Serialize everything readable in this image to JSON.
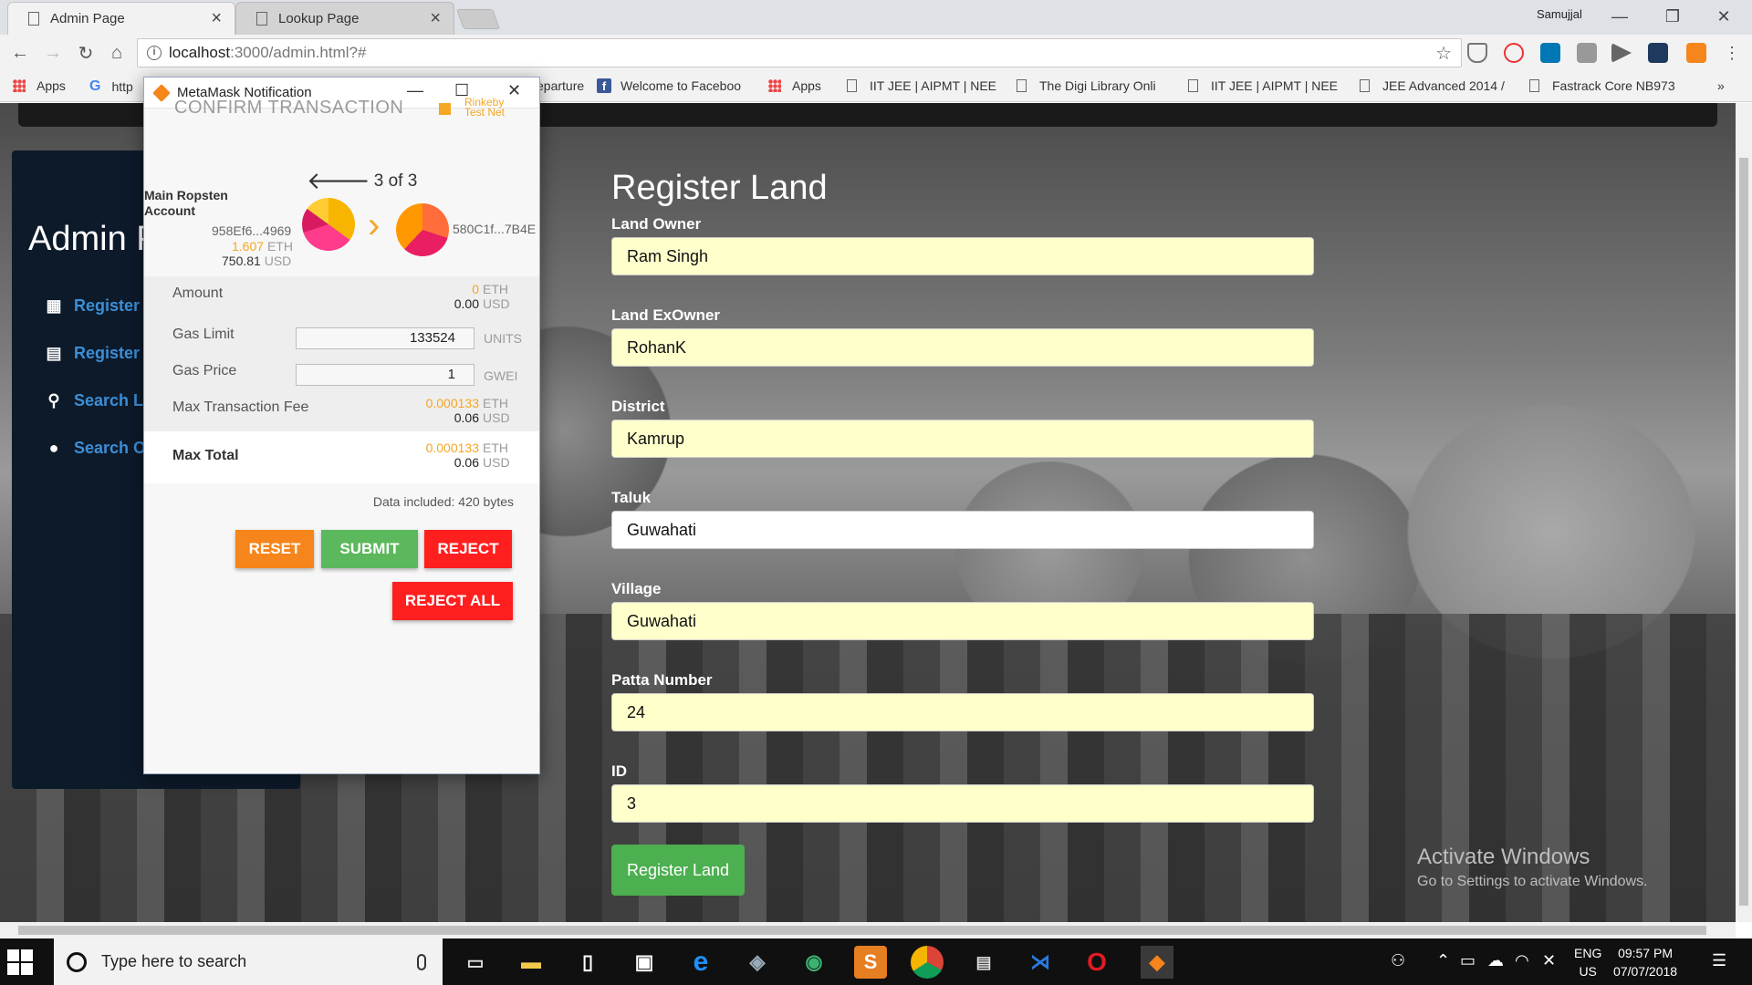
{
  "browser": {
    "tabs": [
      {
        "title": "Admin Page"
      },
      {
        "title": "Lookup Page"
      }
    ],
    "profile_name": "Samujjal",
    "url_host": "localhost",
    "url_path": ":3000/admin.html?#",
    "bookmarks": [
      "Apps",
      "http",
      "eparture",
      "Welcome to Faceboo",
      "Apps",
      "IIT JEE | AIPMT | NEE",
      "The Digi Library Onli",
      "IIT JEE | AIPMT | NEE",
      "JEE Advanced 2014 /",
      "Fastrack Core NB973"
    ],
    "bookmarks_overflow": "»"
  },
  "page": {
    "sidebar": {
      "title": "Admin P",
      "items": [
        {
          "label": "Register",
          "icon": "grid-icon"
        },
        {
          "label": "Register (",
          "icon": "list-icon"
        },
        {
          "label": "Search La",
          "icon": "search-icon"
        },
        {
          "label": "Search Ow",
          "icon": "user-icon"
        }
      ]
    },
    "form": {
      "title": "Register Land",
      "fields": [
        {
          "label": "Land Owner",
          "value": "Ram Singh"
        },
        {
          "label": "Land ExOwner",
          "value": "RohanK"
        },
        {
          "label": "District",
          "value": "Kamrup"
        },
        {
          "label": "Taluk",
          "value": "Guwahati"
        },
        {
          "label": "Village",
          "value": "Guwahati"
        },
        {
          "label": "Patta Number",
          "value": "24"
        },
        {
          "label": "ID",
          "value": "3"
        }
      ],
      "submit_label": "Register Land"
    },
    "activate": {
      "line1": "Activate Windows",
      "line2": "Go to Settings to activate Windows."
    }
  },
  "metamask": {
    "window_title": "MetaMask Notification",
    "header": "CONFIRM TRANSACTION",
    "network": [
      "Rinkeby",
      "Test Net"
    ],
    "counter": "3 of 3",
    "from_account": [
      "Main Ropsten",
      "Account"
    ],
    "from_address": "958Ef6...4969",
    "from_balance_eth": "1.607",
    "from_balance_usd": "750.81",
    "to_address": "580C1f...7B4E",
    "amount_label": "Amount",
    "amount_eth": "0",
    "amount_usd": "0.00",
    "gas_limit_label": "Gas Limit",
    "gas_limit": "133524",
    "gas_limit_unit": "UNITS",
    "gas_price_label": "Gas Price",
    "gas_price": "1",
    "gas_price_unit": "GWEI",
    "max_fee_label": "Max Transaction Fee",
    "max_fee_eth": "0.000133",
    "max_fee_usd": "0.06",
    "max_total_label": "Max Total",
    "max_total_eth": "0.000133",
    "max_total_usd": "0.06",
    "eth_unit": "ETH",
    "usd_unit": "USD",
    "data_included": "Data included: 420 bytes",
    "buttons": {
      "reset": "RESET",
      "submit": "SUBMIT",
      "reject": "REJECT",
      "reject_all": "REJECT ALL"
    },
    "colors": {
      "orange": "#f6851b",
      "green": "#5cb85c",
      "red": "#ff1f1f"
    }
  },
  "taskbar": {
    "search_placeholder": "Type here to search",
    "language": [
      "ENG",
      "US"
    ],
    "time": "09:57 PM",
    "date": "07/07/2018"
  }
}
